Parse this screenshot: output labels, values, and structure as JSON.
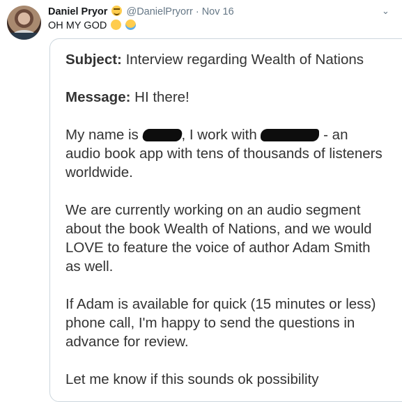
{
  "tweet": {
    "author_name": "Daniel Pryor",
    "author_handle": "@DanielPryorr",
    "separator": "·",
    "date": "Nov 16",
    "text": "OH MY GOD"
  },
  "email": {
    "subject_label": "Subject:",
    "subject": "Interview regarding Wealth of Nations",
    "message_label": "Message:",
    "greeting": "HI there!",
    "p1_start": "My name is",
    "p1_mid": ", I work with",
    "p1_end": "- an audio book app with tens of thousands of listeners worldwide.",
    "p2": "We are currently working on an audio segment about the book Wealth of Nations, and we would LOVE to feature the voice of author Adam Smith as well.",
    "p3": "If Adam is available for quick (15 minutes or less) phone call, I'm happy to send the questions in advance for review.",
    "p4_partial": "Let me know if this sounds ok possibility"
  },
  "icons": [
    "grinning-face-emoji",
    "tears-of-joy-emoji",
    "crying-face-emoji",
    "chevron-down-icon",
    "avatar"
  ]
}
